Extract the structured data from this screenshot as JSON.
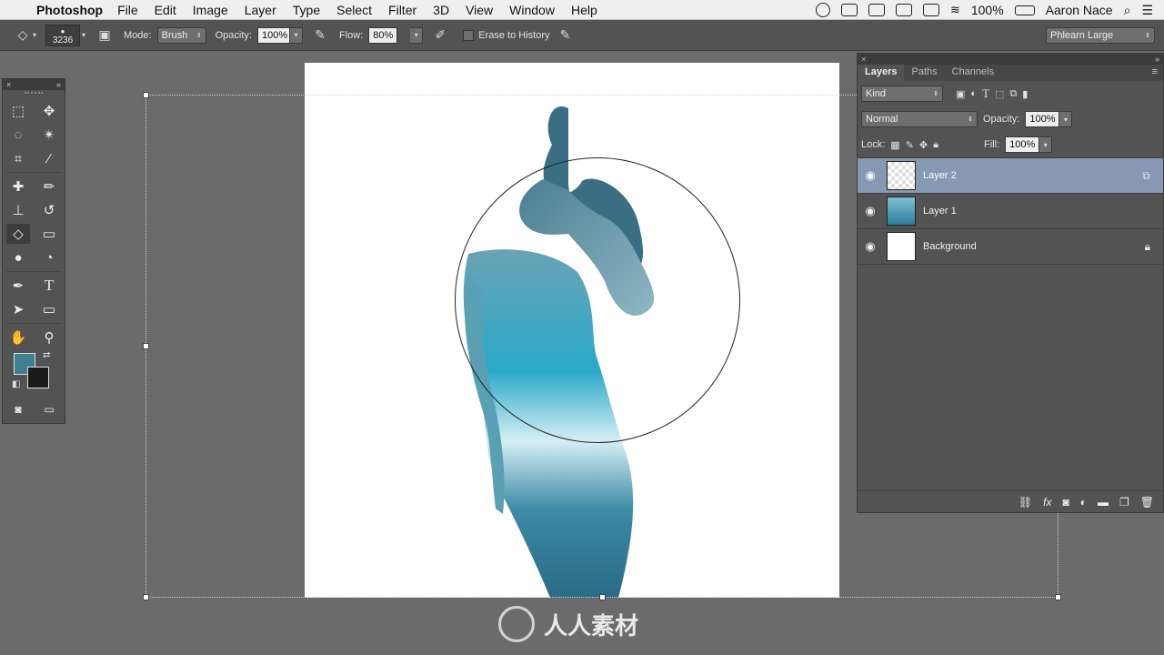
{
  "menubar": {
    "app_name": "Photoshop",
    "items": [
      "File",
      "Edit",
      "Image",
      "Layer",
      "Type",
      "Select",
      "Filter",
      "3D",
      "View",
      "Window",
      "Help"
    ],
    "battery": "100%",
    "user": "Aaron Nace"
  },
  "options": {
    "brush_size": "3236",
    "mode_label": "Mode:",
    "mode_value": "Brush",
    "opacity_label": "Opacity:",
    "opacity_value": "100%",
    "flow_label": "Flow:",
    "flow_value": "80%",
    "erase_to_history": "Erase to History",
    "workspace": "Phlearn Large"
  },
  "colors": {
    "foreground": "#3f7f93",
    "background": "#1b1b1b"
  },
  "layers_panel": {
    "tabs": [
      "Layers",
      "Paths",
      "Channels"
    ],
    "filter_kind": "Kind",
    "blend_mode": "Normal",
    "opacity_label": "Opacity:",
    "opacity_value": "100%",
    "lock_label": "Lock:",
    "fill_label": "Fill:",
    "fill_value": "100%",
    "layers": [
      {
        "name": "Layer 2",
        "selected": true
      },
      {
        "name": "Layer 1",
        "selected": false
      },
      {
        "name": "Background",
        "selected": false,
        "locked": true
      }
    ]
  },
  "watermark": "人人素材"
}
